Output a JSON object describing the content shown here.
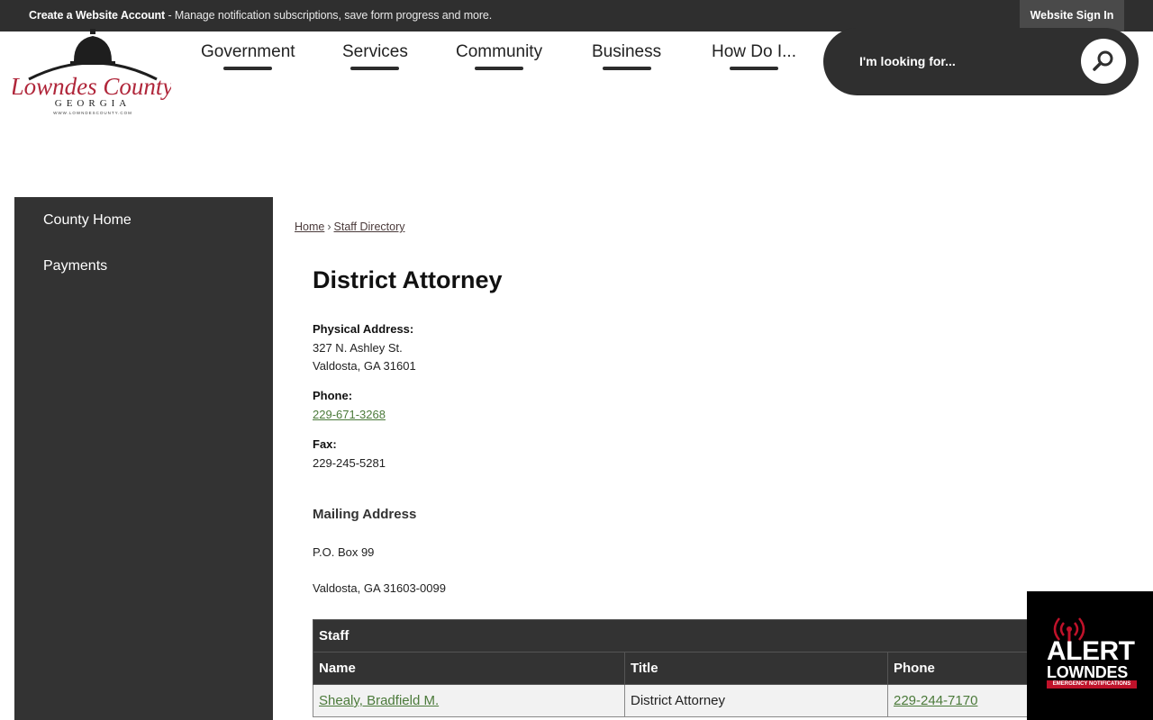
{
  "topbar": {
    "create_account": "Create a Website Account",
    "message": " - Manage notification subscriptions, save form progress and more.",
    "signin_label": "Website Sign In"
  },
  "logo": {
    "line1": "Lowndes County",
    "line2": "GEORGIA",
    "line3": "WWW.LOWNDESCOUNTY.COM",
    "color": "#b0263a"
  },
  "nav": {
    "items": [
      "Government",
      "Services",
      "Community",
      "Business",
      "How Do I..."
    ]
  },
  "search": {
    "placeholder": "I'm looking for..."
  },
  "sidebar": {
    "items": [
      "County Home",
      "Payments"
    ]
  },
  "breadcrumb": {
    "home": "Home",
    "separator": "›",
    "current": "Staff Directory"
  },
  "department": {
    "title": "District Attorney",
    "physical_label": "Physical Address:",
    "physical_line1": "327 N. Ashley St.",
    "physical_line2": "Valdosta, GA 31601",
    "phone_label": "Phone:",
    "phone": "229-671-3268",
    "fax_label": "Fax:",
    "fax": "229-245-5281",
    "mailing_heading": "Mailing Address",
    "mailing_line1": "P.O. Box 99",
    "mailing_line2": "Valdosta, GA 31603-0099"
  },
  "staff_table": {
    "caption": "Staff",
    "headers": [
      "Name",
      "Title",
      "Phone"
    ],
    "rows": [
      [
        "Shealy, Bradfield M.",
        "District Attorney",
        "229-244-7170"
      ]
    ]
  },
  "alert_badge": {
    "title": "ALERT",
    "subtitle": "LOWNDES",
    "strip": "EMERGENCY NOTIFICATIONS",
    "accent": "#c0122a"
  },
  "colors": {
    "dark_bar": "#2f2f2f",
    "sidebar": "#333333",
    "link_green": "#4b7a3a"
  }
}
